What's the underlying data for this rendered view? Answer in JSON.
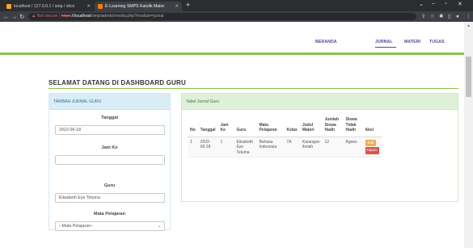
{
  "browser": {
    "tab1_title": "localhost / 127.0.0.1 / smp / skcx",
    "tab2_title": "E-Learning SMPS Katolik Mater",
    "url_warning": "Not secure",
    "url_scheme": "https",
    "url_host": "localhost",
    "url_path": "/smp/admin/media.php?module=jurnal",
    "colors": {
      "chrome_dark": "#2b2d31",
      "chrome_mid": "#3c3f44",
      "tab2_favicon": "#f57c00",
      "tab1_favicon": "#f5a623"
    }
  },
  "nav": {
    "links": [
      "BERANDA",
      "JURNAL",
      "MATERI",
      "TUGAS"
    ],
    "active": "JURNAL",
    "accent": "#4a4a9e"
  },
  "main": {
    "heading": "SELAMAT DATANG DI DASHBOARD GURU",
    "accent_green": "#8bc34a"
  },
  "form": {
    "title": "TAMBAH JURNAL GURU",
    "tanggal_label": "Tanggal",
    "tanggal_value": "2022-06-18",
    "jamke_label": "Jam Ke",
    "jamke_value": "",
    "guru_label": "Guru",
    "guru_value": "Elisabeth Eye Teluma",
    "mapel_label": "Mata Pelajaran",
    "mapel_value": "--Mata Pelajaran--"
  },
  "table": {
    "title": "Tabel Jurnal Guru",
    "headers": [
      "No",
      "Tanggal",
      "Jam Ke",
      "Guru",
      "Mata Pelajaran",
      "Kelas",
      "Judul Materi",
      "Jumlah Siswa Hadir",
      "Siswa Tidak Hadir",
      "Aksi"
    ],
    "rows": [
      {
        "no": "1",
        "tanggal": "2022-06-18",
        "jamke": "1",
        "guru": "Elisabeth Eye Teluma",
        "mapel": "Bahasa Indonesia",
        "kelas": "7A",
        "judul": "Karangan Ilmiah",
        "hadir": "12",
        "tidak_hadir": "Agnes",
        "edit_label": "Edit",
        "hapus_label": "Hapus"
      }
    ]
  }
}
